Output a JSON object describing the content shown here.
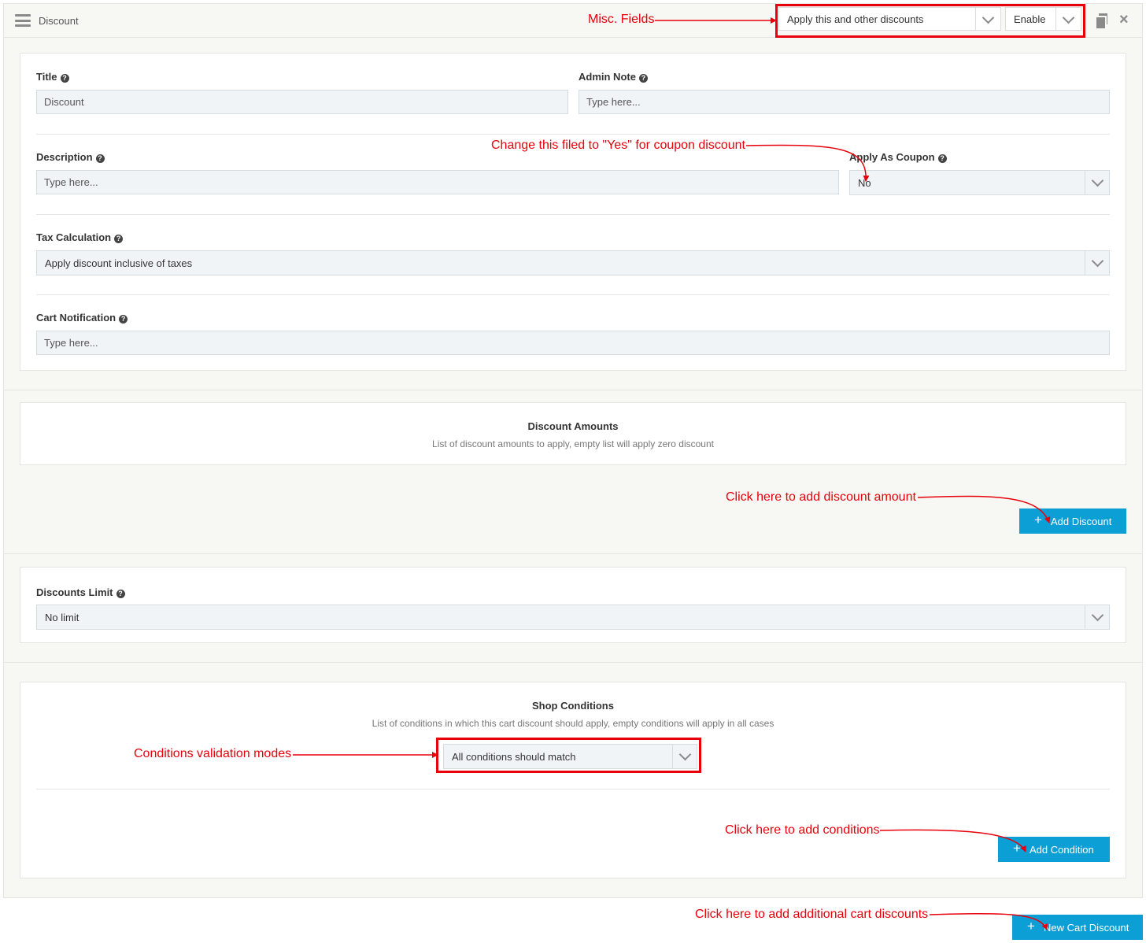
{
  "header": {
    "title": "Discount",
    "apply_mode": "Apply this and other discounts",
    "status": "Enable"
  },
  "form": {
    "title_label": "Title",
    "title_value": "Discount",
    "admin_note_label": "Admin Note",
    "admin_note_placeholder": "Type here...",
    "description_label": "Description",
    "description_placeholder": "Type here...",
    "coupon_label": "Apply As Coupon",
    "coupon_value": "No",
    "tax_label": "Tax Calculation",
    "tax_value": "Apply discount inclusive of taxes",
    "notification_label": "Cart Notification",
    "notification_placeholder": "Type here..."
  },
  "amounts": {
    "title": "Discount Amounts",
    "subtitle": "List of discount amounts to apply, empty list will apply zero discount",
    "add_button": "Add Discount"
  },
  "limit": {
    "label": "Discounts Limit",
    "value": "No limit"
  },
  "conditions": {
    "title": "Shop Conditions",
    "subtitle": "List of conditions in which this cart discount should apply, empty conditions will apply in all cases",
    "mode_value": "All conditions should match",
    "add_button": "Add Condition"
  },
  "footer": {
    "new_button": "New Cart Discount"
  },
  "annotations": {
    "misc": "Misc. Fields",
    "coupon": "Change this filed to \"Yes\" for coupon discount",
    "add_amount": "Click here to add discount amount",
    "validation": "Conditions validation modes",
    "add_conditions": "Click here to add conditions",
    "add_cart_discount": "Click here to add additional cart discounts"
  },
  "colors": {
    "accent": "#0c9fd6",
    "annotation": "#e8000b",
    "panel_bg": "#f7f7f3",
    "input_bg": "#f0f4f7"
  },
  "icons": [
    "hamburger-icon",
    "copy-icon",
    "close-icon",
    "help-icon",
    "chevron-down-icon",
    "plus-icon"
  ]
}
